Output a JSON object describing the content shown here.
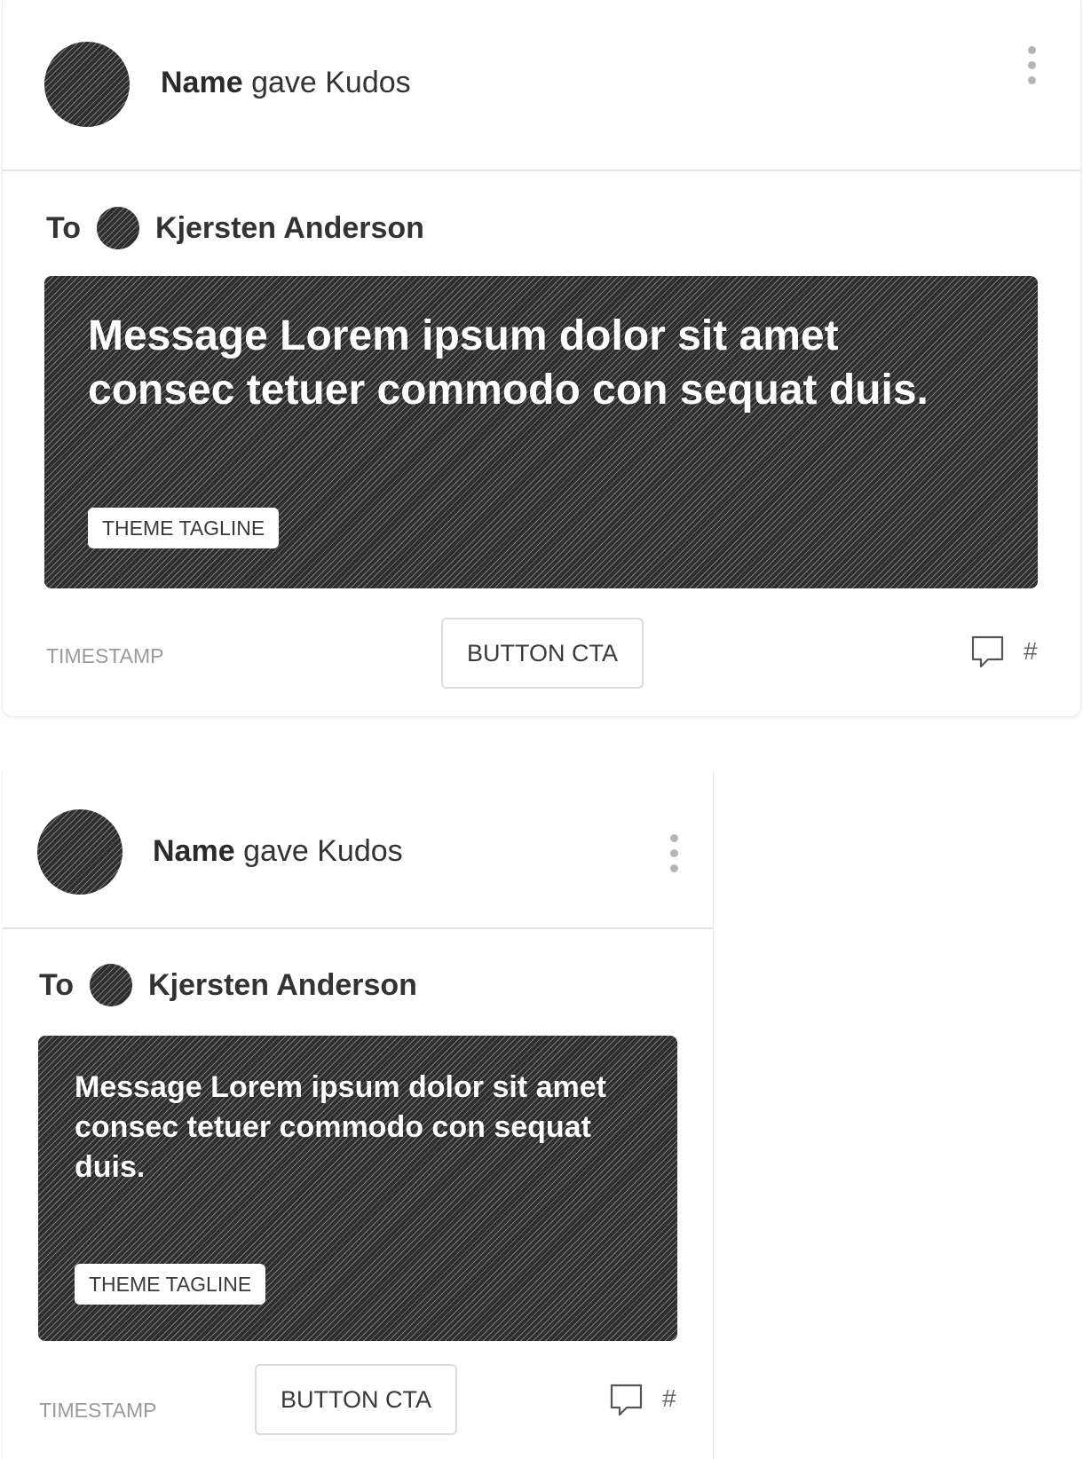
{
  "cards": [
    {
      "header": {
        "name": "Name",
        "action": "gave Kudos"
      },
      "recipient": {
        "prefix": "To",
        "name": "Kjersten Anderson"
      },
      "message": "Message Lorem ipsum dolor sit amet consec tetuer commodo con sequat duis.",
      "tagline": "THEME TAGLINE",
      "footer": {
        "timestamp": "TIMESTAMP",
        "cta": "BUTTON CTA",
        "comment_count": "#"
      }
    },
    {
      "header": {
        "name": "Name",
        "action": "gave Kudos"
      },
      "recipient": {
        "prefix": "To",
        "name": "Kjersten Anderson"
      },
      "message": "Message Lorem ipsum dolor sit amet consec tetuer commodo con sequat duis.",
      "tagline": "THEME TAGLINE",
      "footer": {
        "timestamp": "TIMESTAMP",
        "cta": "BUTTON CTA",
        "comment_count": "#"
      }
    }
  ],
  "icons": {
    "menu": "kebab-vertical-icon",
    "comment": "speech-bubble-icon"
  },
  "colors": {
    "message_bg": "#3c3c3c",
    "divider": "#e3e3e3",
    "muted_text": "#9a9a9a"
  }
}
